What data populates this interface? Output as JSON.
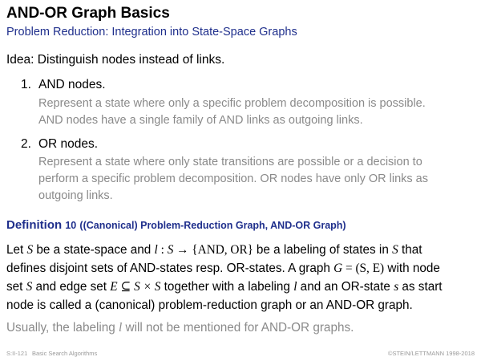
{
  "title": "AND-OR Graph Basics",
  "subtitle": "Problem Reduction: Integration into State-Space Graphs",
  "idea": "Idea: Distinguish nodes instead of links.",
  "items": [
    {
      "number": "1.",
      "title": "AND nodes.",
      "lines": [
        "Represent a state where only a specific problem decomposition is possible.",
        "AND nodes have a single family of AND links as outgoing links."
      ]
    },
    {
      "number": "2.",
      "title": "OR nodes.",
      "lines": [
        "Represent a state where only state transitions are possible or a decision to",
        "perform a specific problem decomposition. OR nodes have only OR links as",
        "outgoing links."
      ]
    }
  ],
  "definition": {
    "label": "Definition",
    "number": "10",
    "name": "((Canonical) Problem-Reduction Graph, AND-OR Graph)",
    "line1": {
      "t1": "Let ",
      "S": "S",
      "t2": " be a state-space and ",
      "l": "l",
      "colon": " : ",
      "S2": "S",
      "arrow": " → {AND, OR} ",
      "t3": "be a labeling of states in ",
      "S3": "S",
      "t4": " that"
    },
    "line2": {
      "t1": "defines disjoint sets of AND-states resp. OR-states. A graph ",
      "G": "G",
      "eq": " = (S, E)",
      "t2": " with node"
    },
    "line3": {
      "t1": "set ",
      "S": "S",
      "t2": " and edge set ",
      "E": "E ⊆ S × S",
      "t3": " together with a labeling ",
      "l": "l",
      "t4": " and an OR-state ",
      "s": "s",
      "t5": " as start"
    },
    "line4": "node is called a (canonical) problem-reduction graph or an AND-OR graph."
  },
  "note": {
    "t1": "Usually, the labeling ",
    "l": "l",
    "t2": " will not be mentioned for AND-OR graphs."
  },
  "footer": {
    "left1": "S:II-121",
    "left2": "Basic Search Algorithms",
    "right": "©STEIN/LETTMANN 1998-2018"
  }
}
